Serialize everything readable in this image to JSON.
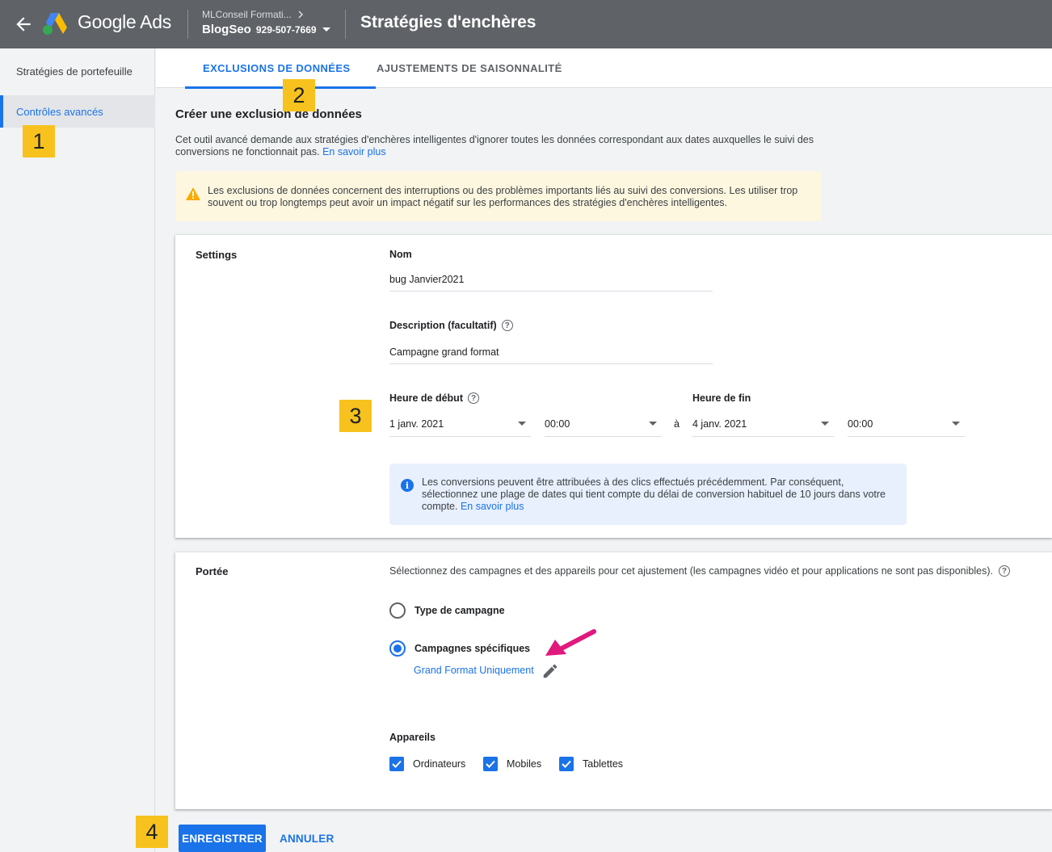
{
  "header": {
    "brand": "Google Ads",
    "account_name": "MLConseil Formati...",
    "account_blog": "BlogSeo",
    "account_id": "929-507-7669",
    "page_title": "Stratégies d'enchères"
  },
  "sidebar": {
    "items": [
      {
        "label": "Stratégies de portefeuille"
      },
      {
        "label": "Contrôles avancés"
      }
    ]
  },
  "tabs": [
    {
      "label": "EXCLUSIONS DE DONNÉES"
    },
    {
      "label": "AJUSTEMENTS DE SAISONNALITÉ"
    }
  ],
  "badges": [
    "1",
    "2",
    "3",
    "4"
  ],
  "main": {
    "title": "Créer une exclusion de données",
    "intro": "Cet outil avancé demande aux stratégies d'enchères intelligentes d'ignorer toutes les données correspondant aux dates auxquelles le suivi des conversions ne fonctionnait pas.",
    "intro_link": "En savoir plus",
    "warning": "Les exclusions de données concernent des interruptions ou des problèmes importants liés au suivi des conversions. Les utiliser trop souvent ou trop longtemps peut avoir un impact négatif sur les performances des stratégies d'enchères intelligentes."
  },
  "settings": {
    "section_label": "Settings",
    "name_label": "Nom",
    "name_value": "bug Janvier2021",
    "desc_label": "Description (facultatif)",
    "desc_value": "Campagne grand format",
    "start_label": "Heure de début",
    "start_date": "1 janv. 2021",
    "start_time": "00:00",
    "to": "à",
    "end_label": "Heure de fin",
    "end_date": "4 janv. 2021",
    "end_time": "00:00",
    "info": "Les conversions peuvent être attribuées à des clics effectués précédemment. Par conséquent, sélectionnez une plage de dates qui tient compte du délai de conversion habituel de 10 jours dans votre compte.",
    "info_link": "En savoir plus"
  },
  "scope": {
    "section_label": "Portée",
    "description": "Sélectionnez des campagnes et des appareils pour cet ajustement (les campagnes vidéo et pour applications ne sont pas disponibles).",
    "radio_type": "Type de campagne",
    "radio_specific": "Campagnes spécifiques",
    "selected_campaign": "Grand Format Uniquement",
    "devices_label": "Appareils",
    "devices": [
      "Ordinateurs",
      "Mobiles",
      "Tablettes"
    ]
  },
  "actions": {
    "save": "ENREGISTRER",
    "cancel": "ANNULER"
  },
  "colors": {
    "accent": "#1a73e8",
    "header": "#5f6368",
    "badge": "#f7c21d",
    "annotation_arrow": "#e0197d"
  }
}
